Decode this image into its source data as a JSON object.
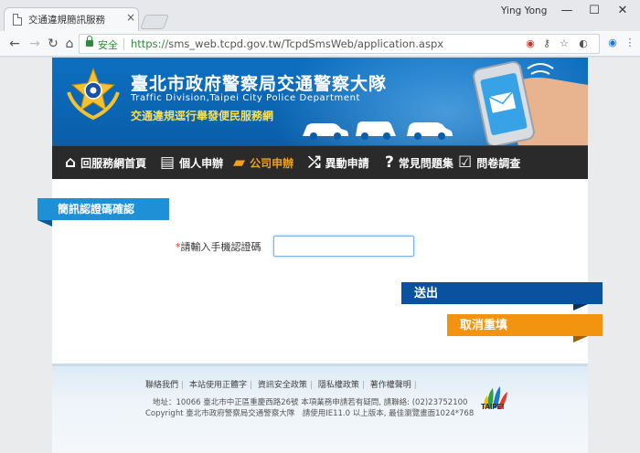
{
  "window": {
    "tab_title": "交通違規簡訊服務",
    "tab_close": "×",
    "user_name": "Ying Yong",
    "minimize": "—",
    "maximize": "☐",
    "close": "✕"
  },
  "toolbar": {
    "back": "←",
    "forward": "→",
    "reload": "↻",
    "home": "⌂",
    "secure_label": "安全",
    "url_protocol": "https://",
    "url_rest": "sms_web.tcpd.gov.tw/TcpdSmsWeb/application.aspx",
    "icons": [
      "cookie-blocked-icon",
      "key-icon",
      "star-icon",
      "extension-icon",
      "chrome-extension-icon",
      "menu-icon"
    ]
  },
  "header": {
    "title_zh": "臺北市政府警察局交通警察大隊",
    "title_en": "Traffic Division,Taipei City Police Department",
    "subtitle": "交通違規逕行舉發便民服務網"
  },
  "menu": {
    "items": [
      {
        "label": "回服務網首頁",
        "icon": "home-icon",
        "glyph": "⌂"
      },
      {
        "label": "個人申辦",
        "icon": "document-icon",
        "glyph": "▤"
      },
      {
        "label": "公司申辦",
        "icon": "folder-icon",
        "glyph": "▰"
      },
      {
        "label": "異動申請",
        "icon": "shuffle-icon",
        "glyph": "⤮"
      },
      {
        "label": "常見問題集",
        "icon": "question-icon",
        "glyph": "?"
      },
      {
        "label": "問卷調查",
        "icon": "survey-icon",
        "glyph": "☑"
      }
    ],
    "active_index": 2
  },
  "form": {
    "section_title": "簡訊認證碼確認",
    "required_mark": "*",
    "field_label": "請輸入手機認證碼",
    "field_value": "",
    "submit_label": "送出",
    "reset_label": "取消重填"
  },
  "footer": {
    "links": [
      "聯絡我們",
      "本站使用正體字",
      "資訊安全政策",
      "隱私權政策",
      "著作權聲明"
    ],
    "address": "地址：10066 臺北市中正區重慶西路26號 本項業務申請若有疑問, 請聯絡: (02)23752100",
    "copyright": "Copyright 臺北市政府警察局交通警察大隊　請使用IE11.0 以上版本, 最佳瀏覽畫面1024*768",
    "logo_text": "TAIPEI"
  },
  "colors": {
    "banner_blue": "#0d6fc1",
    "menu_dark": "#2a2a2a",
    "active_orange": "#f2a01a",
    "section_blue": "#1f8fd6",
    "submit_navy": "#0a52a0",
    "reset_orange": "#f29410"
  }
}
